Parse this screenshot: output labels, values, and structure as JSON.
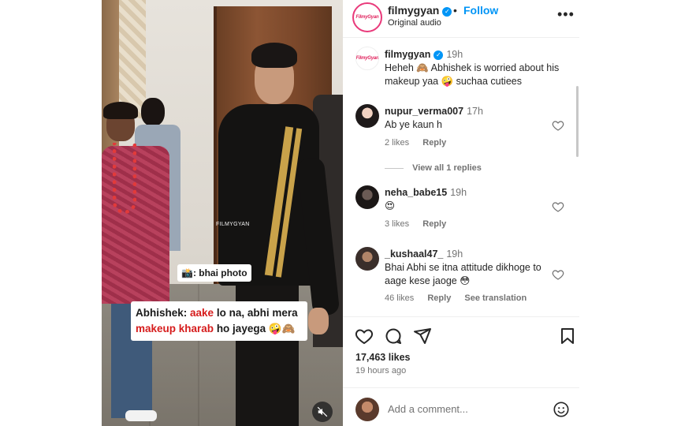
{
  "post": {
    "author": "filmygyan",
    "follow_label": "Follow",
    "separator": "•",
    "audio": "Original audio",
    "more_icon": "more-horizontal-icon",
    "logo_text": "FilmyGyan",
    "verified_icon": "✓"
  },
  "video": {
    "watermark": "FILMYGYAN",
    "caption1": "📸: bhai photo",
    "caption2_speaker": "Abhishek:",
    "caption2_red1": "aake",
    "caption2_mid": "lo na, abhi mera",
    "caption2_red2": "makeup kharab",
    "caption2_end": "ho jayega 🤪🙈",
    "mute_icon": "speaker-muted-icon"
  },
  "caption": {
    "user": "filmygyan",
    "time": "19h",
    "text": "Heheh 🙈 Abhishek is worried about his makeup yaa 🤪 suchaa cutiees"
  },
  "comments": [
    {
      "user": "nupur_verma007",
      "time": "17h",
      "text": "Ab ye kaun h",
      "likes": "2 likes",
      "reply": "Reply",
      "view_replies": "View all 1 replies"
    },
    {
      "user": "neha_babe15",
      "time": "19h",
      "text": "😍",
      "likes": "3 likes",
      "reply": "Reply"
    },
    {
      "user": "_kushaal47_",
      "time": "19h",
      "text": "Bhai Abhi se itna attitude dikhoge to aage kese jaoge 😳",
      "likes": "46 likes",
      "reply": "Reply",
      "translate": "See translation"
    }
  ],
  "actions": {
    "likes": "17,463 likes",
    "posted": "19 hours ago",
    "add_comment_placeholder": "Add a comment...",
    "icons": [
      "heart-icon",
      "comment-icon",
      "share-icon",
      "bookmark-icon",
      "emoji-icon"
    ]
  },
  "colors": {
    "accent": "#0095f6",
    "text": "#262626",
    "muted": "#737373",
    "caption_red": "#d61c1c"
  }
}
